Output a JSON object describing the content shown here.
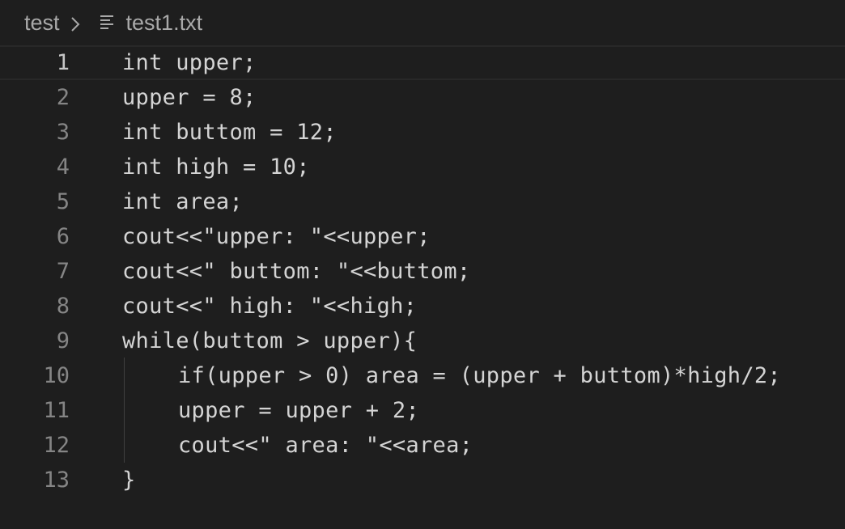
{
  "breadcrumb": {
    "folder": "test",
    "file": "test1.txt"
  },
  "icons": {
    "chevron": "chevron-right-icon",
    "file": "text-file-icon"
  },
  "colors": {
    "background": "#1e1e1e",
    "text": "#d4d4d4",
    "line_number": "#858585",
    "line_number_active": "#c6c6c6"
  },
  "editor": {
    "lines": [
      {
        "number": "1",
        "code": "int upper;"
      },
      {
        "number": "2",
        "code": "upper = 8;"
      },
      {
        "number": "3",
        "code": "int buttom = 12;"
      },
      {
        "number": "4",
        "code": "int high = 10;"
      },
      {
        "number": "5",
        "code": "int area;"
      },
      {
        "number": "6",
        "code": "cout<<\"upper: \"<<upper;"
      },
      {
        "number": "7",
        "code": "cout<<\" buttom: \"<<buttom;"
      },
      {
        "number": "8",
        "code": "cout<<\" high: \"<<high;"
      },
      {
        "number": "9",
        "code": "while(buttom > upper){"
      },
      {
        "number": "10",
        "code": "if(upper > 0) area = (upper + buttom)*high/2;"
      },
      {
        "number": "11",
        "code": "upper = upper + 2;"
      },
      {
        "number": "12",
        "code": "cout<<\" area: \"<<area;"
      },
      {
        "number": "13",
        "code": "}"
      }
    ]
  }
}
